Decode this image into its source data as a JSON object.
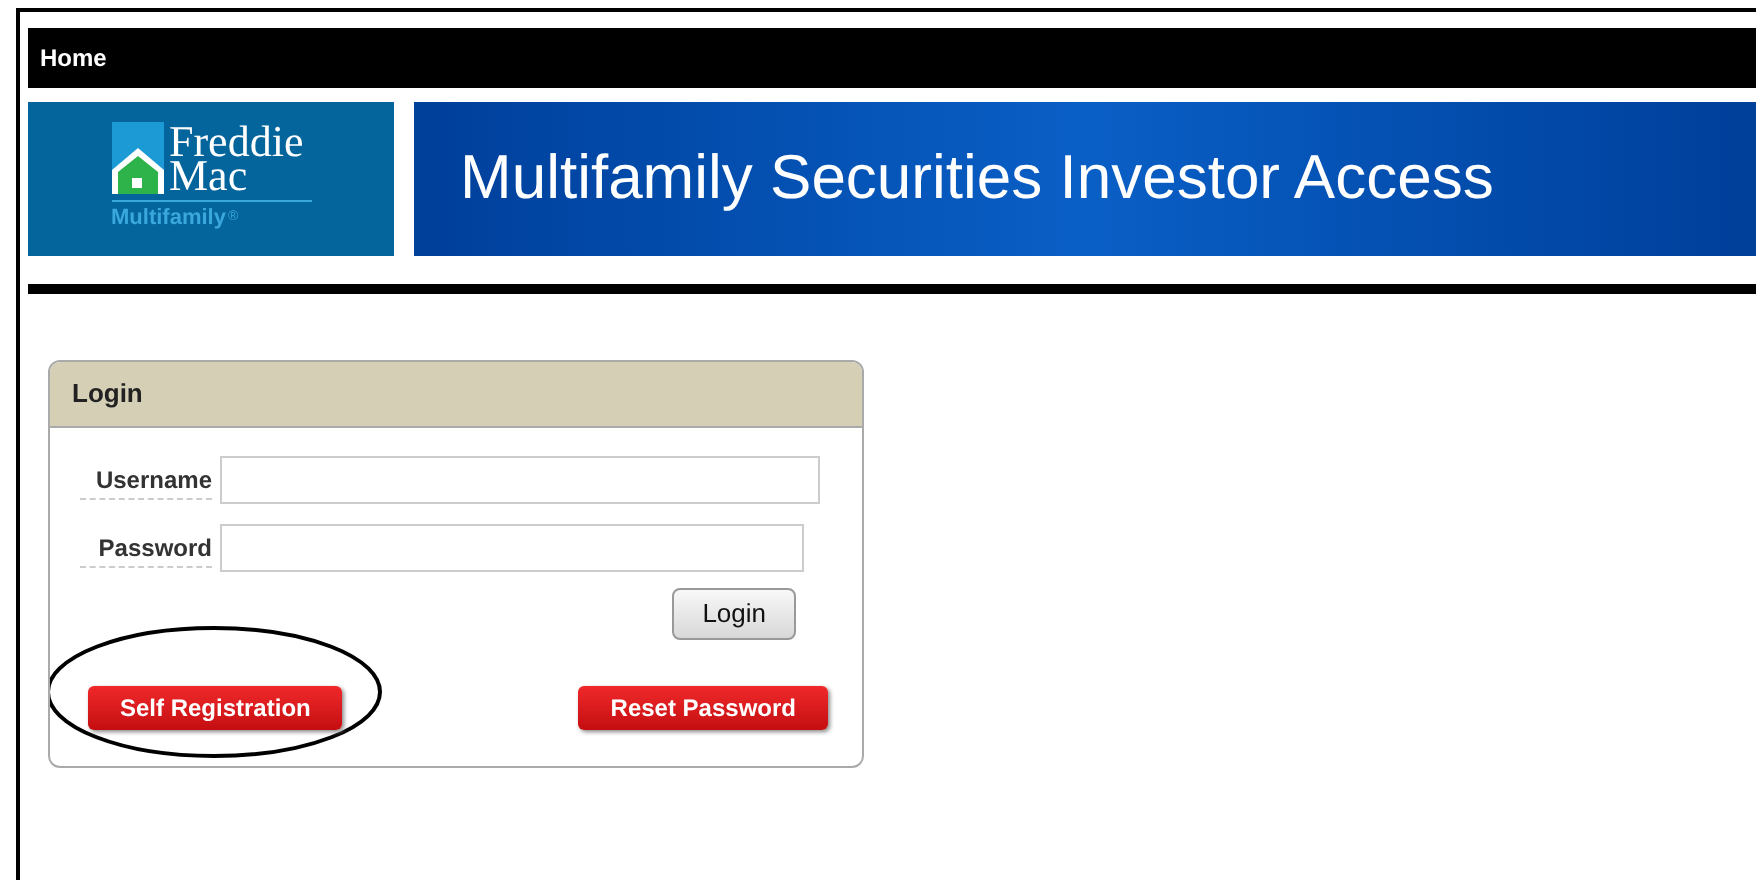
{
  "nav": {
    "home": "Home"
  },
  "logo": {
    "line_1": "Freddie",
    "line_2": "Mac",
    "sub": "Multifamily",
    "mark": "®"
  },
  "banner": {
    "title": "Multifamily Securities Investor Access"
  },
  "login": {
    "title": "Login",
    "fields": [
      {
        "label": "Username"
      },
      {
        "label": "Password"
      }
    ],
    "submit": "Login",
    "buttons": [
      {
        "label": "Self Registration",
        "circled": true
      },
      {
        "label": "Reset Password",
        "circled": false
      }
    ]
  }
}
